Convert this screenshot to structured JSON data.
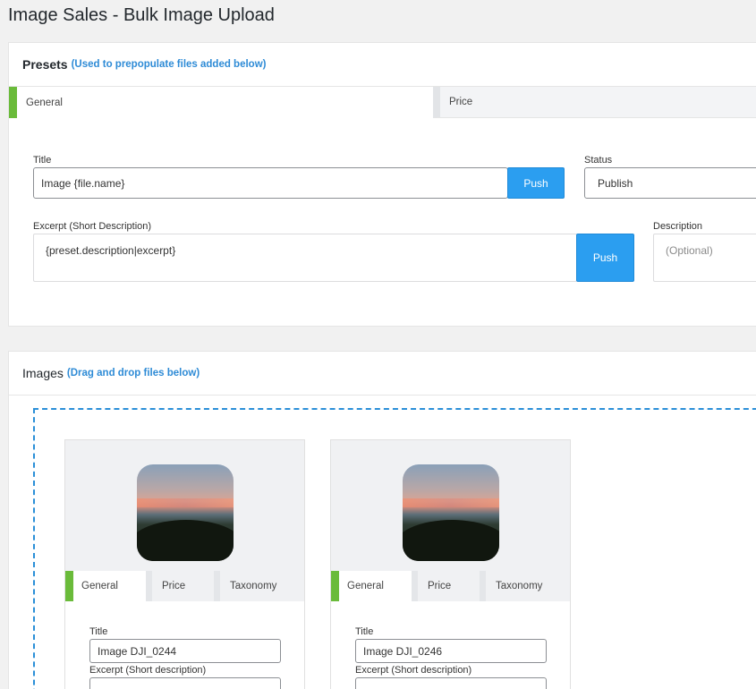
{
  "page": {
    "title": "Image Sales - Bulk Image Upload"
  },
  "presets": {
    "heading": "Presets",
    "hint": "(Used to prepopulate files added below)",
    "tabs": [
      {
        "label": "General"
      },
      {
        "label": "Price"
      }
    ],
    "title_label": "Title",
    "title_value": "Image {file.name}",
    "title_push": "Push",
    "status_label": "Status",
    "status_value": "Publish",
    "excerpt_label": "Excerpt (Short Description)",
    "excerpt_value": "{preset.description|excerpt}",
    "excerpt_push": "Push",
    "description_label": "Description",
    "description_placeholder": "(Optional)"
  },
  "images": {
    "heading": "Images",
    "hint": "(Drag and drop files below)",
    "cards": [
      {
        "tabs": [
          "General",
          "Price",
          "Taxonomy"
        ],
        "title_label": "Title",
        "title_value": "Image DJI_0244",
        "excerpt_label": "Excerpt (Short description)"
      },
      {
        "tabs": [
          "General",
          "Price",
          "Taxonomy"
        ],
        "title_label": "Title",
        "title_value": "Image DJI_0246",
        "excerpt_label": "Excerpt (Short description)"
      }
    ]
  },
  "colors": {
    "accent_blue": "#2b9ef0",
    "active_tab": "#6abb3a",
    "link_blue": "#2e8bd6"
  }
}
